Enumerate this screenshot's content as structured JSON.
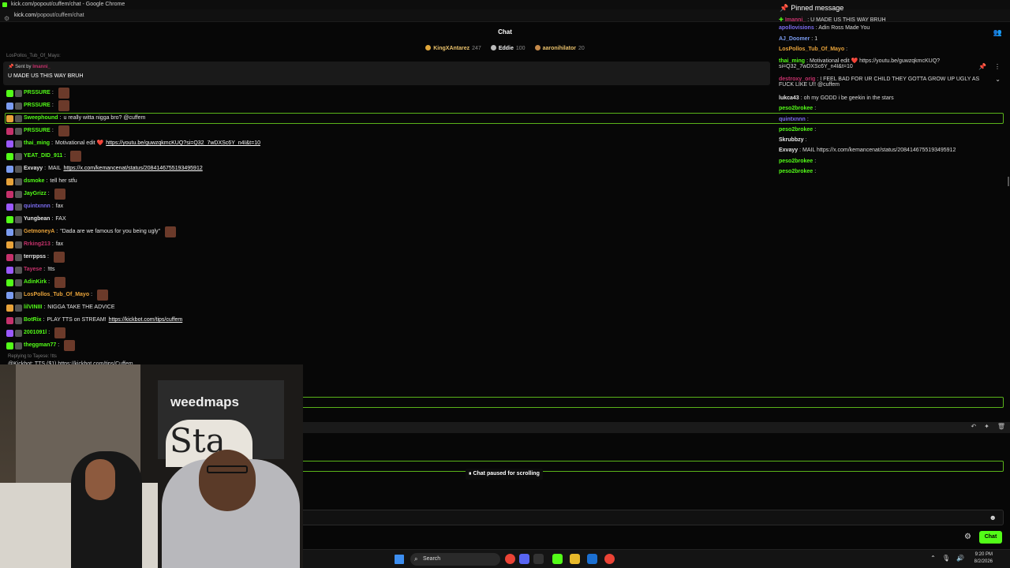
{
  "browser": {
    "title": "kick.com/popout/cuffem/chat - Google Chrome",
    "url_host": "kick.com",
    "url_path": "/popout/cuffem/chat"
  },
  "header": {
    "title": "Chat"
  },
  "gifters": [
    {
      "name": "KingXAntarez",
      "count": "247"
    },
    {
      "name": "Eddie",
      "count": "100"
    },
    {
      "name": "aaronihilator",
      "count": "20"
    }
  ],
  "pinned": {
    "sent_by_label": "Sent by",
    "sender": "Imanni_",
    "message": "U MADE US THIS WAY BRUH",
    "cut_above": "LosPollos_Tub_Of_Mayo:"
  },
  "left_messages": [
    {
      "user": "PRSSURE",
      "sep": ":",
      "text": "",
      "color": "#53fc18",
      "emote": true
    },
    {
      "user": "PRSSURE",
      "sep": ":",
      "text": "",
      "color": "#53fc18",
      "emote": true
    },
    {
      "user": "Sweephound",
      "sep": ":",
      "text": "u really witta nigga bro? @cuffem",
      "color": "#53fc18",
      "emote": false
    },
    {
      "user": "PRSSURE",
      "sep": ":",
      "text": "",
      "color": "#53fc18",
      "emote": true
    },
    {
      "user": "thai_ming",
      "sep": ":",
      "text": "Motivational edit ❤️",
      "link": "https://youtu.be/guwzqkmcKUQ?si=Q32_7wDXSc6Y_n4I&t=10",
      "color": "#53fc18",
      "emote": false
    },
    {
      "user": "YEAT_DID_911",
      "sep": ":",
      "text": "",
      "color": "#53fc18",
      "emote": true
    },
    {
      "user": "Exvayy",
      "sep": ":",
      "text": "MAIL",
      "link": "https://x.com/kemancenat/status/2084146755193495912",
      "color": "#e6e6e6",
      "emote": false
    },
    {
      "user": "dsmoke",
      "sep": ":",
      "text": "tell her stfu",
      "color": "#53fc18",
      "emote": false
    },
    {
      "user": "JayGrizz",
      "sep": ":",
      "text": "",
      "color": "#53fc18",
      "emote": true
    },
    {
      "user": "quintxnnn",
      "sep": ":",
      "text": "fax",
      "color": "#7b6cf0",
      "emote": false
    },
    {
      "user": "Yungbean",
      "sep": ":",
      "text": "FAX",
      "color": "#e6e6e6",
      "emote": false
    },
    {
      "user": "GetmoneyA",
      "sep": ":",
      "text": "\"Dada are we famous for you being ugly\"",
      "color": "#e8a33a",
      "emote": true
    },
    {
      "user": "Rrking213",
      "sep": ":",
      "text": "fax",
      "color": "#c5316b",
      "emote": false
    },
    {
      "user": "terrppss",
      "sep": ":",
      "text": "",
      "color": "#e6e6e6",
      "emote": true
    },
    {
      "user": "Tayese",
      "sep": ":",
      "text": "!tts",
      "color": "#c5316b",
      "emote": false
    },
    {
      "user": "AdinKirk",
      "sep": ":",
      "text": "",
      "color": "#53fc18",
      "emote": true
    },
    {
      "user": "LosPollos_Tub_Of_Mayo",
      "sep": ":",
      "text": "",
      "color": "#e8a33a",
      "emote": true
    },
    {
      "user": "lilVINIII",
      "sep": ":",
      "text": "NIGGA TAKE THE ADVICE",
      "color": "#53fc18",
      "emote": false
    },
    {
      "user": "BotRix",
      "sep": ":",
      "text": "PLAY TTS on STREAM!",
      "link": "https://kickbot.com/tips/cuffem",
      "color": "#53fc18",
      "emote": false
    },
    {
      "user": "2001091l",
      "sep": ":",
      "text": "",
      "color": "#53fc18",
      "emote": true
    },
    {
      "user": "theggman77",
      "sep": ":",
      "text": "",
      "color": "#53fc18",
      "emote": true
    }
  ],
  "reply_hint": "Replying to Tayese: !tts",
  "reply_cut": "@Kickbot: TTS ($1) https://kickbot.com/tips/Cuffem",
  "right_panel": {
    "title": "Pinned message",
    "pinned_user": "Imanni_",
    "pinned_text": "U MADE US THIS WAY BRUH",
    "rows": [
      {
        "user": "apollovisions",
        "text": "Adin Ross Made You",
        "color": "#7b6cf0"
      },
      {
        "user": "AJ_Doomer",
        "text": "1",
        "color": "#7b9cf0"
      },
      {
        "user": "LosPollos_Tub_Of_Mayo",
        "text": "",
        "color": "#e8a33a"
      },
      {
        "user": "thai_ming",
        "text": "Motivational edit ❤️ https://youtu.be/guwzqkmcKUQ?si=Q32_7wDXSc6Y_n4I&t=10",
        "color": "#53fc18"
      },
      {
        "user": "destroxy_orig",
        "text": "I FEEL BAD FOR UR CHILD THEY GOTTA GROW UP UGLY AS FUCK LIKE U!! @cuffem",
        "color": "#c5316b"
      },
      {
        "user": "lukca43",
        "text": "oh my GODD i be geekin in the stars",
        "color": "#e6e6e6"
      },
      {
        "user": "peso2brokee",
        "text": "",
        "color": "#53fc18"
      },
      {
        "user": "quintxnnn",
        "text": "",
        "color": "#7b6cf0"
      },
      {
        "user": "peso2brokee",
        "text": "",
        "color": "#53fc18"
      },
      {
        "user": "Skrubbzy",
        "text": "",
        "color": "#e6e6e6"
      },
      {
        "user": "Exvayy",
        "text": "MAIL https://x.com/kemancenat/status/2084146755193495912",
        "color": "#e6e6e6"
      },
      {
        "user": "peso2brokee",
        "text": "",
        "color": "#53fc18"
      },
      {
        "user": "peso2brokee",
        "text": "",
        "color": "#53fc18"
      }
    ]
  },
  "status": {
    "paused": "Chat paused for scrolling"
  },
  "input": {
    "placeholder": ""
  },
  "actions": {
    "chat_button": "Chat"
  },
  "webcam": {
    "banner_text": "weedmaps",
    "sign_text": "Sta"
  },
  "taskbar": {
    "search": "Search",
    "time": "9:20 PM",
    "date": "8/2/2026"
  },
  "colors": {
    "accent": "#53fc18",
    "highlight_border": "#5ab31a"
  }
}
